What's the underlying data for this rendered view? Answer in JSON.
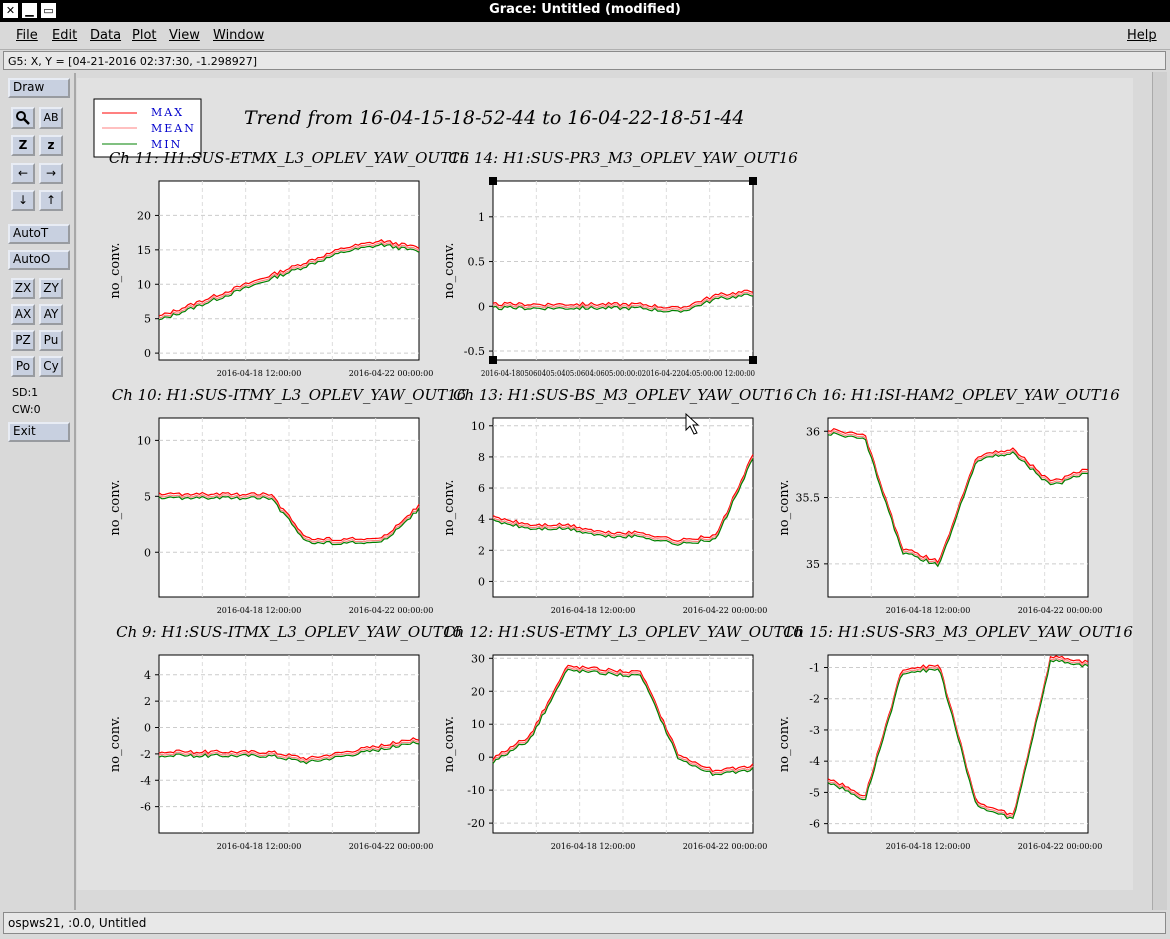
{
  "window": {
    "title": "Grace: Untitled (modified)",
    "close_glyph": "✕",
    "minimize_glyph": "▁",
    "maximize_glyph": "▭"
  },
  "menu": {
    "file": "File",
    "edit": "Edit",
    "data": "Data",
    "plot": "Plot",
    "view": "View",
    "window": "Window",
    "help": "Help"
  },
  "locator": "G5: X, Y = [04-21-2016 02:37:30, -1.298927]",
  "tools": {
    "draw": "Draw",
    "zoom_glyph": "🔍",
    "text_glyph": "AB",
    "z_big": "Z",
    "z_small": "z",
    "left": "←",
    "right": "→",
    "down": "↓",
    "up": "↑",
    "autot": "AutoT",
    "autoo": "AutoO",
    "zx": "ZX",
    "zy": "ZY",
    "ax": "AX",
    "ay": "AY",
    "pz": "PZ",
    "pu": "Pu",
    "po": "Po",
    "cy": "Cy",
    "sd": "SD:1",
    "cw": "CW:0",
    "exit": "Exit"
  },
  "status": "ospws21, :0.0, Untitled",
  "colors": {
    "max": "#ff0000",
    "mean": "#ff8080",
    "min": "#008000",
    "legend_text": "#0000cc"
  },
  "chart_data": {
    "type": "line",
    "title": "Trend from 16-04-15-18-52-44 to 16-04-22-18-51-44",
    "legend": [
      "MAX",
      "MEAN",
      "MIN"
    ],
    "legend_position": "top-left",
    "ylabel": "no_conv.",
    "x_ticks": [
      "2016-04-18 12:00:00",
      "2016-04-22 00:00:00"
    ],
    "panels": [
      {
        "title": "Ch 11: H1:SUS-ETMX_L3_OPLEV_YAW_OUT16",
        "yticks": [
          "0",
          "5",
          "10",
          "15",
          "20"
        ],
        "ylim": [
          -1,
          25
        ],
        "y": [
          5,
          7,
          9,
          11,
          13,
          15,
          16,
          15
        ]
      },
      {
        "title": "Ch 14: H1:SUS-PR3_M3_OPLEV_YAW_OUT16",
        "yticks": [
          "-0.5",
          "0",
          "0.5",
          "1"
        ],
        "ylim": [
          -0.6,
          1.4
        ],
        "y": [
          0,
          0,
          0,
          0,
          0,
          -0.05,
          0.1,
          0.15
        ],
        "xtick_overlap": "2016-04-1805060405:0405:0604:0605:00:00:02016-04-2204:05:00:00 12:00:00"
      },
      {
        "title": "Ch 10: H1:SUS-ITMY_L3_OPLEV_YAW_OUT16",
        "yticks": [
          "0",
          "5",
          "10"
        ],
        "ylim": [
          -4,
          12
        ],
        "y": [
          5,
          5,
          5,
          5,
          1,
          1,
          1,
          4
        ]
      },
      {
        "title": "Ch 13: H1:SUS-BS_M3_OPLEV_YAW_OUT16",
        "yticks": [
          "0",
          "2",
          "4",
          "6",
          "8",
          "10"
        ],
        "ylim": [
          -1,
          10.5
        ],
        "y": [
          4,
          3.5,
          3.5,
          3,
          3,
          2.5,
          2.8,
          8
        ]
      },
      {
        "title": "Ch 16: H1:ISI-HAM2_OPLEV_YAW_OUT16",
        "yticks": [
          "35",
          "35.5",
          "36"
        ],
        "ylim": [
          34.75,
          36.1
        ],
        "y": [
          36,
          35.95,
          35.1,
          35.0,
          35.8,
          35.85,
          35.6,
          35.7
        ]
      },
      {
        "title": "Ch 9: H1:SUS-ITMX_L3_OPLEV_YAW_OUT16",
        "yticks": [
          "-6",
          "-4",
          "-2",
          "0",
          "2",
          "4"
        ],
        "ylim": [
          -8,
          5.5
        ],
        "y": [
          -2,
          -2,
          -2,
          -2,
          -2.5,
          -2,
          -1.5,
          -1
        ]
      },
      {
        "title": "Ch 12: H1:SUS-ETMY_L3_OPLEV_YAW_OUT16",
        "yticks": [
          "-20",
          "-10",
          "0",
          "10",
          "20",
          "30"
        ],
        "ylim": [
          -23,
          31
        ],
        "y": [
          -1,
          6,
          27,
          26,
          25,
          0,
          -5,
          -3
        ]
      },
      {
        "title": "Ch 15: H1:SUS-SR3_M3_OPLEV_YAW_OUT16",
        "yticks": [
          "-6",
          "-5",
          "-4",
          "-3",
          "-2",
          "-1"
        ],
        "ylim": [
          -6.3,
          -0.6
        ],
        "y": [
          -4.6,
          -5.2,
          -1.1,
          -1.0,
          -5.4,
          -5.8,
          -0.7,
          -0.9
        ]
      }
    ]
  }
}
